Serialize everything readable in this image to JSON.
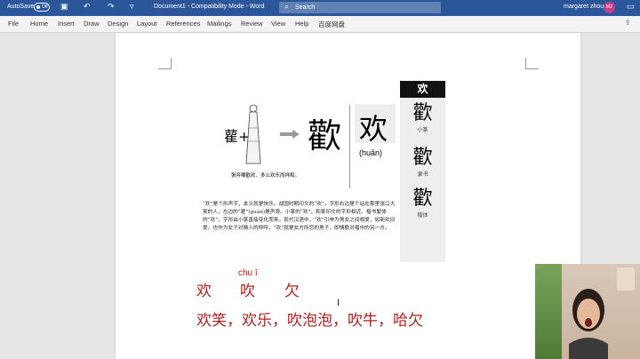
{
  "titlebar": {
    "autosave_label": "AutoSave",
    "autosave_state": "Off",
    "doc_title": "Document1 - Compatibility Mode - Word",
    "search_placeholder": "Search",
    "user_name": "margaret zhou",
    "avatar_initials": "MZ"
  },
  "tabs": [
    "File",
    "Home",
    "Insert",
    "Draw",
    "Design",
    "Layout",
    "References",
    "Mailings",
    "Review",
    "View",
    "Help",
    "百度网盘"
  ],
  "figure": {
    "small_glyph": "雚+",
    "seal_glyph": "歡",
    "caption": "張弃嘲歡欢，多么欢乐而祥和。",
    "main_char": "欢",
    "pinyin": "(huān)"
  },
  "sidebar": {
    "header": "欢",
    "variants": [
      {
        "glyph": "歡",
        "label": "小篆"
      },
      {
        "glyph": "歡",
        "label": "隶书"
      },
      {
        "glyph": "歡",
        "label": "楷体"
      }
    ]
  },
  "paragraph": "“欢”是个形声字，本义就是快乐。战国时期印文的“欢”，字形右边是个站在那里张口大笑的人，左边的“雚”(guàn)是声旁。小篆的“欢”，和篆印文的字形相近。楷书繁体的“欢”，字形由小篆直接变化而来。现代汉语中，“欢”引申为男女之间相爱，如新欢旧爱。也作为女子对情人的称呼，“欢”就是女方所恋的男子，即情歌对唱中的另一方。",
  "lesson": {
    "row1": [
      "欢",
      "吹",
      "欠"
    ],
    "chui_pinyin": "chu ī",
    "row2": "欢笑，欢乐，吹泡泡，吹牛，哈欠"
  },
  "colors": {
    "word_blue": "#2b579a",
    "lesson_red": "#b21e1e"
  }
}
